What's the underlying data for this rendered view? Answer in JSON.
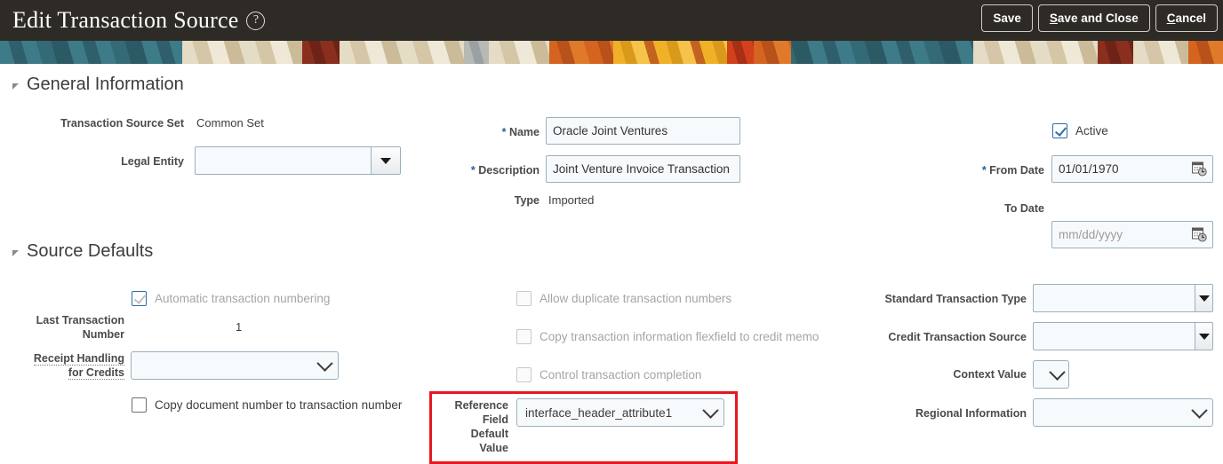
{
  "header": {
    "title": "Edit Transaction Source",
    "help_icon": "help-circle-icon",
    "buttons": [
      {
        "label": "Save",
        "accesskey": ""
      },
      {
        "label": "Save and Close",
        "accesskey": "S"
      },
      {
        "label": "Cancel",
        "accesskey": "C"
      }
    ]
  },
  "sections": {
    "general_information": {
      "title": "General Information",
      "transaction_source_set": {
        "label": "Transaction Source Set",
        "value": "Common Set"
      },
      "legal_entity": {
        "label": "Legal Entity",
        "value": ""
      },
      "name": {
        "label": "Name",
        "required": "*",
        "value": "Oracle Joint Ventures"
      },
      "description": {
        "label": "Description",
        "required": "*",
        "value": "Joint Venture Invoice Transaction"
      },
      "type": {
        "label": "Type",
        "value": "Imported"
      },
      "active": {
        "label": "Active",
        "checked": true
      },
      "from_date": {
        "label": "From Date",
        "required": "*",
        "value": "01/01/1970",
        "placeholder": "mm/dd/yyyy"
      },
      "to_date": {
        "label": "To Date",
        "value": "",
        "placeholder": "mm/dd/yyyy"
      }
    },
    "source_defaults": {
      "title": "Source Defaults",
      "automatic_transaction_numbering": {
        "label": "Automatic transaction numbering",
        "checked": true,
        "disabled": true
      },
      "last_transaction_number": {
        "label": "Last Transaction Number",
        "value": "1"
      },
      "receipt_handling_for_credits": {
        "label_line1": "Receipt Handling",
        "label_line2": "for Credits",
        "value": ""
      },
      "copy_document_number": {
        "label": "Copy document number to transaction number",
        "checked": false,
        "disabled": false
      },
      "allow_duplicate_transaction_numbers": {
        "label": "Allow duplicate transaction numbers",
        "checked": false,
        "disabled": true
      },
      "copy_transaction_information_flexfield": {
        "label": "Copy transaction information flexfield to credit memo",
        "checked": false,
        "disabled": true
      },
      "control_transaction_completion": {
        "label": "Control transaction completion",
        "checked": false,
        "disabled": true
      },
      "reference_field_default_value": {
        "label_line1": "Reference",
        "label_line2": "Field",
        "label_line3": "Default",
        "label_line4": "Value",
        "value": "interface_header_attribute1",
        "highlighted": true
      },
      "standard_transaction_type": {
        "label": "Standard Transaction Type",
        "value": ""
      },
      "credit_transaction_source": {
        "label": "Credit Transaction Source",
        "value": ""
      },
      "context_value": {
        "label": "Context Value",
        "value": ""
      },
      "regional_information": {
        "label": "Regional Information",
        "value": ""
      }
    }
  },
  "colors": {
    "header_bg": "#2e2a26",
    "required_marker": "#2a6496",
    "checkbox_checked": "#2e6da4",
    "highlight_border": "#e8171f",
    "field_border": "#9bb0bd",
    "field_bg": "#f7fafc"
  }
}
